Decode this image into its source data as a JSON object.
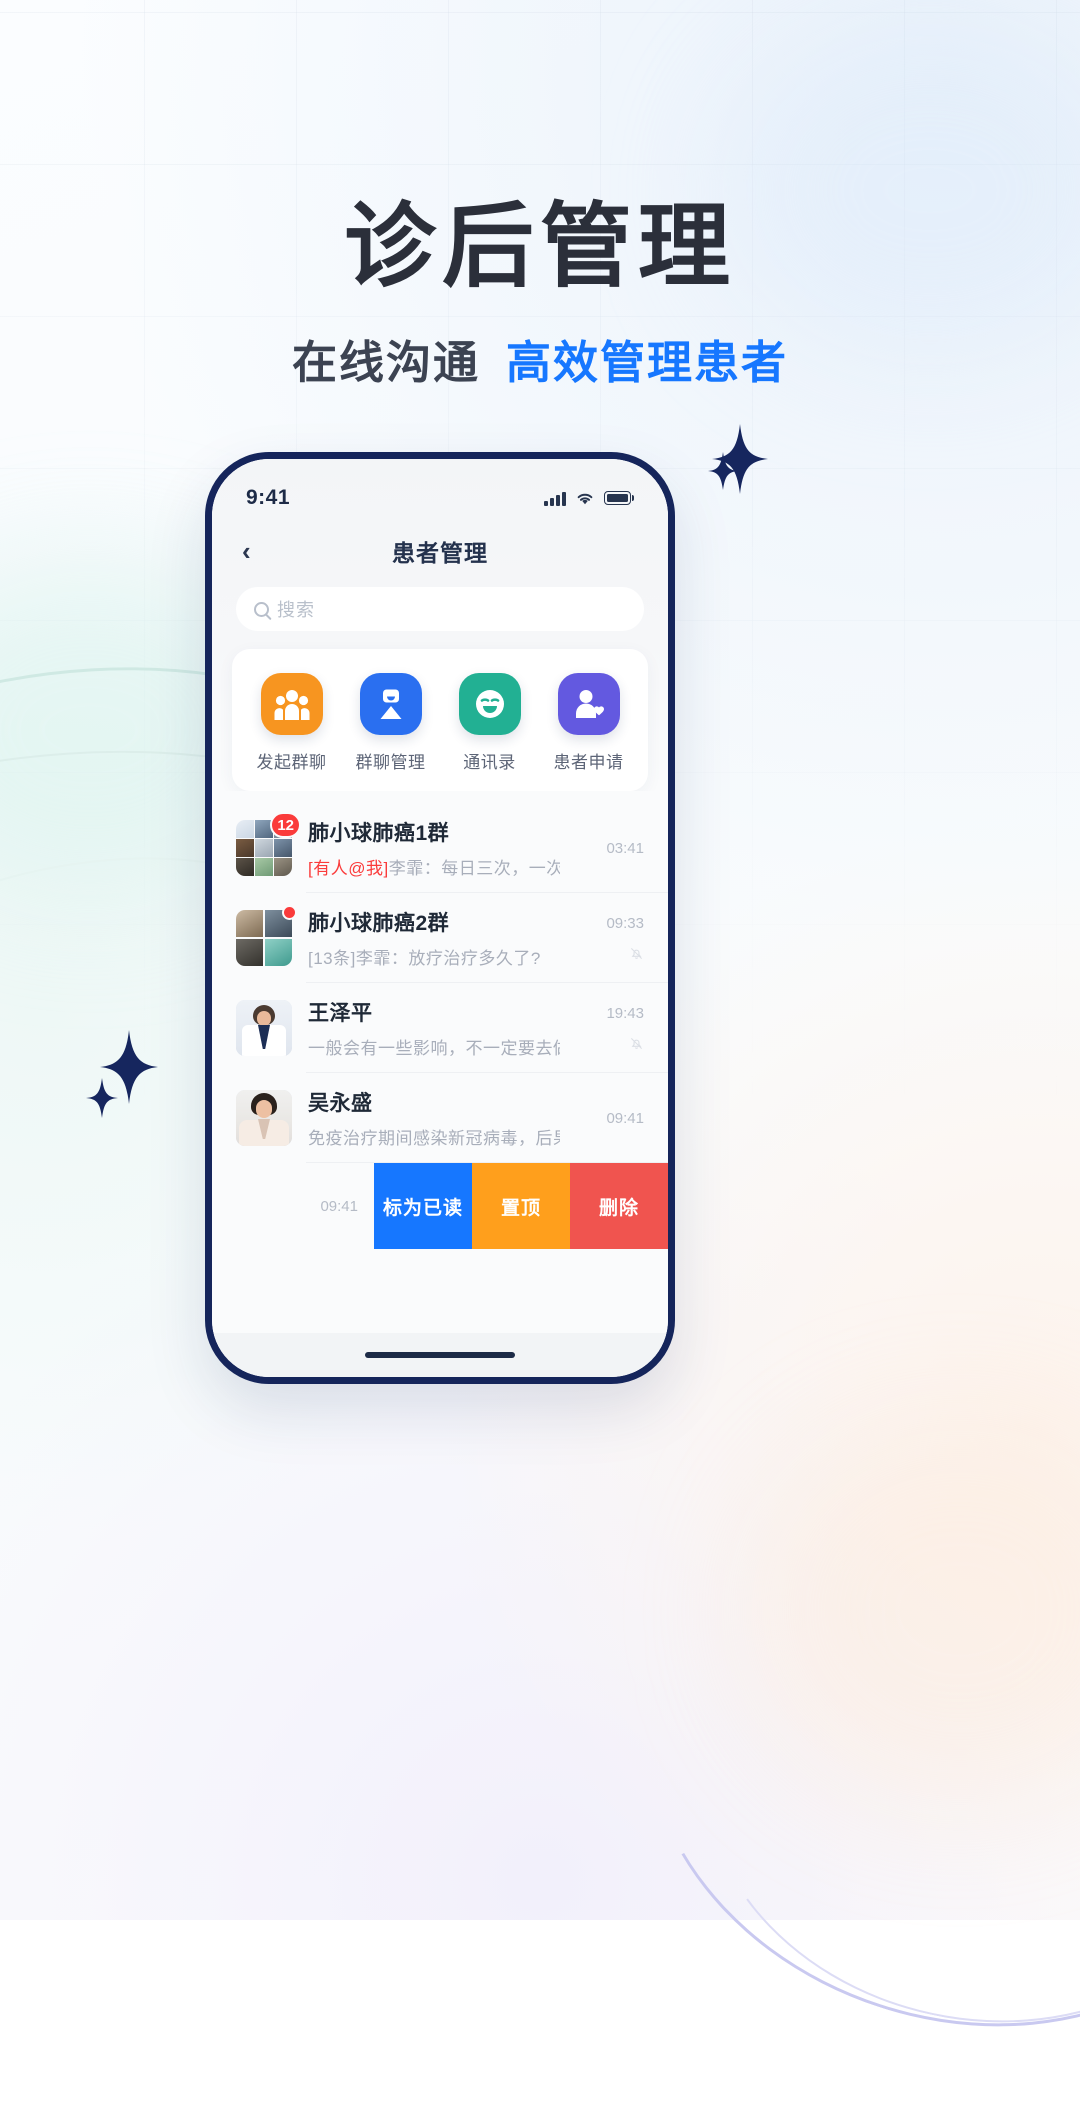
{
  "poster": {
    "headline": "诊后管理",
    "subtitle_plain": "在线沟通",
    "subtitle_accent": "高效管理患者",
    "accent_color": "#1677ff",
    "headline_color": "#2b2f3a"
  },
  "phone": {
    "status_bar": {
      "time": "9:41",
      "signal_icon": "cellular-bars-icon",
      "wifi_icon": "wifi-icon",
      "battery_icon": "battery-full-icon"
    },
    "nav": {
      "back_icon": "chevron-left-icon",
      "title": "患者管理"
    },
    "search": {
      "icon": "search-icon",
      "placeholder": "搜索",
      "value": ""
    },
    "quick_actions": [
      {
        "label": "发起群聊",
        "icon": "group-chat-icon",
        "color": "#f79520"
      },
      {
        "label": "群聊管理",
        "icon": "group-manage-icon",
        "color": "#2a6ff0"
      },
      {
        "label": "通讯录",
        "icon": "contacts-smile-icon",
        "color": "#22b093"
      },
      {
        "label": "患者申请",
        "icon": "patient-apply-icon",
        "color": "#6359e0"
      }
    ],
    "chats": [
      {
        "name": "肺小球肺癌1群",
        "time": "03:41",
        "at_tag": "[有人@我]",
        "message": "李霏：每日三次，一次三片...",
        "badge": "12",
        "badge_kind": "count",
        "avatar_kind": "grid9",
        "muted": false
      },
      {
        "name": "肺小球肺癌2群",
        "time": "09:33",
        "at_tag": "",
        "message": "[13条]李霏：放疗治疗多久了?",
        "badge": "",
        "badge_kind": "dot",
        "avatar_kind": "grid4",
        "muted": true
      },
      {
        "name": "王泽平",
        "time": "19:43",
        "at_tag": "",
        "message": "一般会有一些影响，不一定要去做CT",
        "badge": "",
        "badge_kind": "none",
        "avatar_kind": "photo",
        "muted": true
      },
      {
        "name": "吴永盛",
        "time": "09:41",
        "at_tag": "",
        "message": "免疫治疗期间感染新冠病毒，后果可...",
        "badge": "",
        "badge_kind": "none",
        "avatar_kind": "photo",
        "muted": false
      }
    ],
    "swipe_row": {
      "time": "09:41",
      "actions": [
        {
          "label": "标为已读",
          "color": "#1677ff"
        },
        {
          "label": "置顶",
          "color": "#ff9f1c"
        },
        {
          "label": "删除",
          "color": "#f0544f"
        }
      ]
    },
    "home_indicator": "home-indicator"
  }
}
